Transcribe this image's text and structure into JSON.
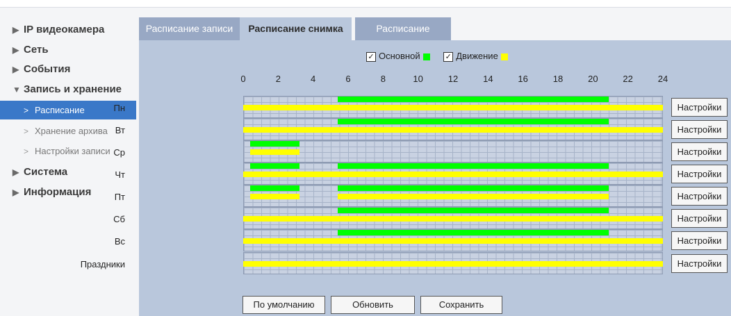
{
  "colors": {
    "primary": "#00ff00",
    "motion": "#ffff00",
    "active_nav": "#3a78c8"
  },
  "sidebar": {
    "sections": [
      {
        "label": "IP видеокамера",
        "arrow": "▶"
      },
      {
        "label": "Сеть",
        "arrow": "▶"
      },
      {
        "label": "События",
        "arrow": "▶"
      },
      {
        "label": "Запись и хранение",
        "arrow": "▼"
      },
      {
        "label": "Система",
        "arrow": "▶"
      },
      {
        "label": "Информация",
        "arrow": "▶"
      }
    ],
    "subitems": [
      {
        "label": "Расписание",
        "active": true
      },
      {
        "label": "Хранение архива",
        "active": false
      },
      {
        "label": "Настройки записи",
        "active": false
      }
    ]
  },
  "tabs": [
    {
      "label": "Расписание записи",
      "active": false
    },
    {
      "label": "Расписание снимка",
      "active": true
    },
    {
      "label": "Расписание",
      "active": false
    }
  ],
  "legend": {
    "primary": {
      "label": "Основной",
      "checked": true
    },
    "motion": {
      "label": "Движение",
      "checked": true
    }
  },
  "hour_labels": [
    "0",
    "2",
    "4",
    "6",
    "8",
    "10",
    "12",
    "14",
    "16",
    "18",
    "20",
    "22",
    "24"
  ],
  "days": [
    {
      "label": "Пн",
      "primary": [
        [
          5.4,
          20.9
        ]
      ],
      "motion": [
        [
          0,
          24
        ]
      ]
    },
    {
      "label": "Вт",
      "primary": [
        [
          5.4,
          20.9
        ]
      ],
      "motion": [
        [
          0,
          24
        ]
      ]
    },
    {
      "label": "Ср",
      "primary": [
        [
          0.4,
          3.2
        ]
      ],
      "motion": [
        [
          0.4,
          3.2
        ]
      ]
    },
    {
      "label": "Чт",
      "primary": [
        [
          0.4,
          3.2
        ],
        [
          5.4,
          20.9
        ]
      ],
      "motion": [
        [
          0,
          24
        ]
      ]
    },
    {
      "label": "Пт",
      "primary": [
        [
          0.4,
          3.2
        ],
        [
          5.4,
          20.9
        ]
      ],
      "motion": [
        [
          0.4,
          3.2
        ],
        [
          5.4,
          20.9
        ]
      ]
    },
    {
      "label": "Сб",
      "primary": [
        [
          5.4,
          20.9
        ]
      ],
      "motion": [
        [
          0,
          24
        ]
      ]
    },
    {
      "label": "Вс",
      "primary": [
        [
          5.4,
          20.9
        ]
      ],
      "motion": [
        [
          0,
          24
        ]
      ]
    },
    {
      "label": "Праздники",
      "primary": [],
      "motion": [
        [
          0,
          24
        ]
      ]
    }
  ],
  "settings_button_label": "Настройки",
  "buttons": {
    "default": "По умолчанию",
    "refresh": "Обновить",
    "save": "Сохранить"
  }
}
